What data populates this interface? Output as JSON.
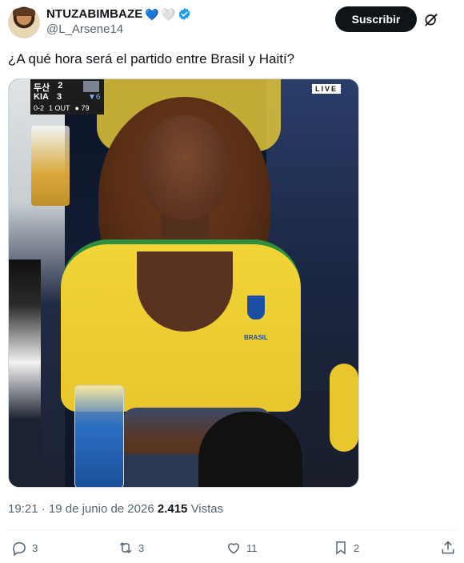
{
  "header": {
    "display_name": "NTUZABIMBAZE",
    "hearts": [
      "💙",
      "🤍"
    ],
    "handle": "@L_Arsene14",
    "subscribe_label": "Suscribir"
  },
  "tweet": {
    "text": "¿A qué hora será el partido entre Brasil y Haití?"
  },
  "media": {
    "scorebug": {
      "team1": "두산",
      "score1": "2",
      "team2": "KIA",
      "score2": "3",
      "inning": "▼6",
      "count": "0-2",
      "outs": "1 OUT",
      "pitches": "● 79"
    },
    "live_badge": "LIVE",
    "crest_text": "BRASIL"
  },
  "meta": {
    "time": "19:21",
    "separator": " · ",
    "date": "19 de junio de 2026",
    "views_count": "2.415",
    "views_label": "Vistas"
  },
  "actions": {
    "replies": "3",
    "reposts": "3",
    "likes": "11",
    "bookmarks": "2"
  },
  "colors": {
    "verified_blue": "#1d9bf0",
    "subscribe_bg": "#0f1419",
    "muted_text": "#536471"
  }
}
